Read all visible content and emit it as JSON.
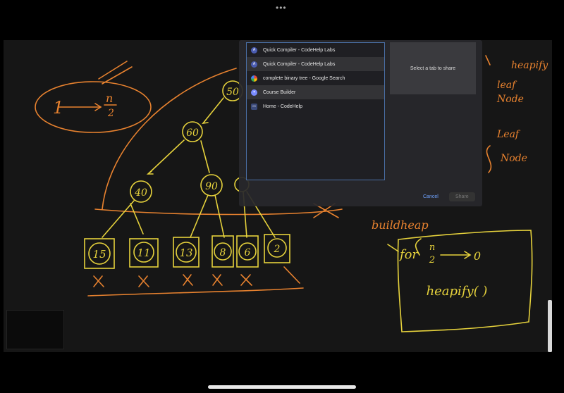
{
  "share_dialog": {
    "tabs": [
      {
        "label": "Quick Compiler - CodeHelp Labs",
        "icon": "codehelp-favicon-icon"
      },
      {
        "label": "Quick Compiler - CodeHelp Labs",
        "icon": "codehelp-favicon-icon"
      },
      {
        "label": "complete binary tree - Google Search",
        "icon": "google-favicon-icon"
      },
      {
        "label": "Course Builder",
        "icon": "course-builder-favicon-icon"
      },
      {
        "label": "Home - CodeHelp",
        "icon": "codehelp-favicon-icon"
      }
    ],
    "preview_text": "Select a tab to share",
    "cancel_label": "Cancel",
    "share_label": "Share"
  },
  "whiteboard": {
    "top_formula": [
      "1",
      "n",
      "2"
    ],
    "tree_nodes": [
      "50",
      "60",
      "40",
      "90",
      "15",
      "11",
      "13",
      "8",
      "6",
      "2"
    ],
    "right_notes": [
      "heapify",
      "leaf",
      "Node",
      "Leaf",
      "Node"
    ],
    "buildheap_title": "buildheap",
    "code": [
      "for",
      "n",
      "2",
      "0",
      "heapify( )"
    ],
    "colors": {
      "orange": "#e8822f",
      "yellow": "#e6d23c",
      "background": "#161616"
    }
  }
}
